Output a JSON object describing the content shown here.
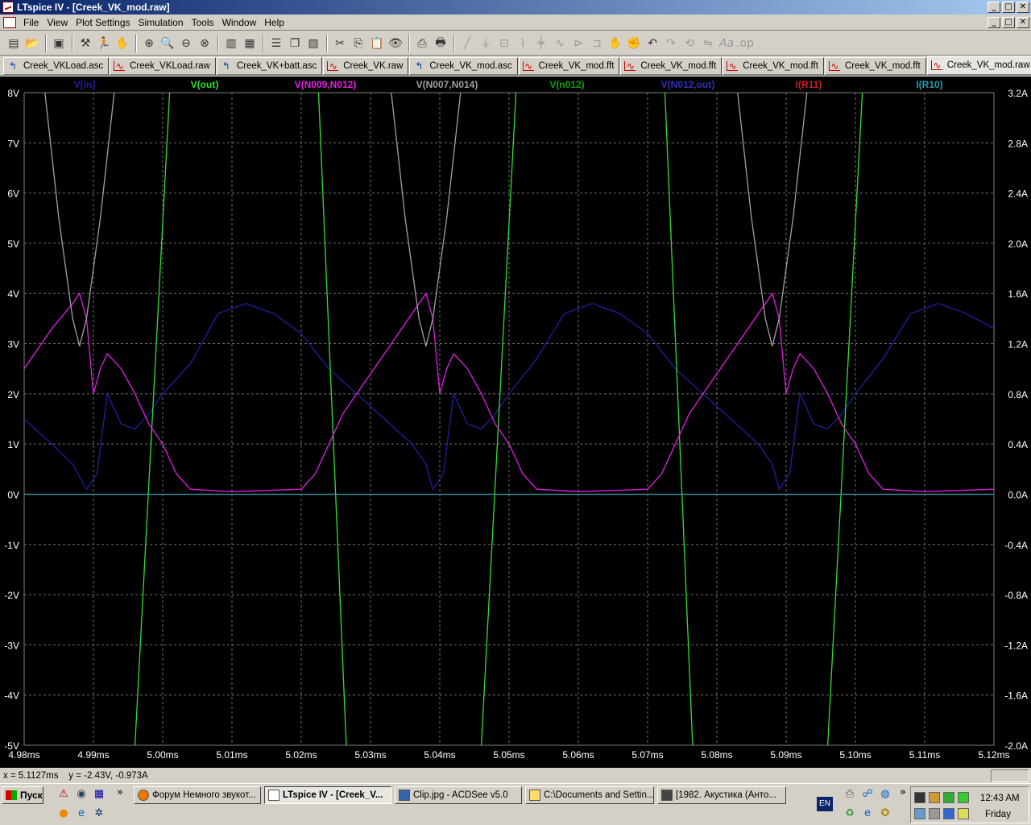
{
  "window": {
    "title": "LTspice IV - [Creek_VK_mod.raw]",
    "btn_min": "_",
    "btn_max": "□",
    "btn_close": "✕"
  },
  "menu": [
    "File",
    "View",
    "Plot Settings",
    "Simulation",
    "Tools",
    "Window",
    "Help"
  ],
  "tabs": [
    {
      "label": "Creek_VKLoad.asc",
      "icon": "schematic-icon"
    },
    {
      "label": "Creek_VKLoad.raw",
      "icon": "waveform-icon"
    },
    {
      "label": "Creek_VK+batt.asc",
      "icon": "schematic-icon"
    },
    {
      "label": "Creek_VK.raw",
      "icon": "waveform-icon"
    },
    {
      "label": "Creek_VK_mod.asc",
      "icon": "schematic-icon"
    },
    {
      "label": "Creek_VK_mod.fft",
      "icon": "waveform-icon"
    },
    {
      "label": "Creek_VK_mod.fft",
      "icon": "waveform-icon"
    },
    {
      "label": "Creek_VK_mod.fft",
      "icon": "waveform-icon"
    },
    {
      "label": "Creek_VK_mod.fft",
      "icon": "waveform-icon"
    },
    {
      "label": "Creek_VK_mod.raw",
      "icon": "waveform-icon"
    }
  ],
  "chart_data": {
    "type": "line",
    "title": "",
    "x_unit": "ms",
    "xlim": [
      4.98,
      5.12
    ],
    "x_ticks": [
      "4.98ms",
      "4.99ms",
      "5.00ms",
      "5.01ms",
      "5.02ms",
      "5.03ms",
      "5.04ms",
      "5.05ms",
      "5.06ms",
      "5.07ms",
      "5.08ms",
      "5.09ms",
      "5.10ms",
      "5.11ms",
      "5.12ms"
    ],
    "ylim_left": [
      -5,
      8
    ],
    "y_ticks_left": [
      "8V",
      "7V",
      "6V",
      "5V",
      "4V",
      "3V",
      "2V",
      "1V",
      "0V",
      "-1V",
      "-2V",
      "-3V",
      "-4V",
      "-5V"
    ],
    "ylim_right": [
      -2.0,
      3.2
    ],
    "y_ticks_right": [
      "3.2A",
      "2.8A",
      "2.4A",
      "2.0A",
      "1.6A",
      "1.2A",
      "0.8A",
      "0.4A",
      "0.0A",
      "-0.4A",
      "-0.8A",
      "-1.2A",
      "-1.6A",
      "-2.0A"
    ],
    "grid": true,
    "background": "#000000",
    "series": [
      {
        "name": "V[in]",
        "color": "#2020a0",
        "axis": "left",
        "points": [
          [
            4.98,
            1.5
          ],
          [
            4.984,
            1.0
          ],
          [
            4.987,
            0.6
          ],
          [
            4.989,
            0.1
          ],
          [
            4.9905,
            0.4
          ],
          [
            4.992,
            2.0
          ],
          [
            4.994,
            1.4
          ],
          [
            4.996,
            1.3
          ],
          [
            4.998,
            1.6
          ],
          [
            5.0,
            2.0
          ],
          [
            5.004,
            2.6
          ],
          [
            5.008,
            3.6
          ],
          [
            5.012,
            3.8
          ],
          [
            5.016,
            3.6
          ],
          [
            5.02,
            3.2
          ],
          [
            5.024,
            2.5
          ],
          [
            5.028,
            2.0
          ],
          [
            5.032,
            1.5
          ],
          [
            5.036,
            1.0
          ],
          [
            5.038,
            0.6
          ],
          [
            5.039,
            0.1
          ],
          [
            5.0405,
            0.4
          ],
          [
            5.042,
            2.0
          ],
          [
            5.044,
            1.4
          ],
          [
            5.046,
            1.3
          ],
          [
            5.048,
            1.6
          ],
          [
            5.05,
            2.0
          ],
          [
            5.054,
            2.7
          ],
          [
            5.058,
            3.6
          ],
          [
            5.062,
            3.8
          ],
          [
            5.066,
            3.6
          ],
          [
            5.07,
            3.2
          ],
          [
            5.074,
            2.5
          ],
          [
            5.078,
            2.0
          ],
          [
            5.082,
            1.5
          ],
          [
            5.086,
            1.0
          ],
          [
            5.088,
            0.6
          ],
          [
            5.089,
            0.1
          ],
          [
            5.0905,
            0.4
          ],
          [
            5.092,
            2.0
          ],
          [
            5.094,
            1.4
          ],
          [
            5.096,
            1.3
          ],
          [
            5.098,
            1.6
          ],
          [
            5.1,
            2.0
          ],
          [
            5.104,
            2.7
          ],
          [
            5.108,
            3.6
          ],
          [
            5.112,
            3.8
          ],
          [
            5.116,
            3.6
          ],
          [
            5.12,
            3.3
          ]
        ]
      },
      {
        "name": "V(out)",
        "color": "#30e030",
        "axis": "left",
        "points": [
          [
            4.996,
            -5
          ],
          [
            5.001,
            8
          ]
        ],
        "segments": [
          [
            [
              4.996,
              -5
            ],
            [
              5.001,
              8
            ]
          ],
          [
            [
              5.0225,
              8
            ],
            [
              5.0265,
              -5
            ]
          ],
          [
            [
              5.046,
              -5
            ],
            [
              5.051,
              8
            ]
          ],
          [
            [
              5.0725,
              8
            ],
            [
              5.0765,
              -5
            ]
          ],
          [
            [
              5.096,
              -5
            ],
            [
              5.101,
              8
            ]
          ]
        ]
      },
      {
        "name": "V(N009,N012)",
        "color": "#e020e0",
        "axis": "left",
        "points": [
          [
            4.98,
            2.5
          ],
          [
            4.984,
            3.3
          ],
          [
            4.987,
            3.8
          ],
          [
            4.988,
            4.0
          ],
          [
            4.989,
            3.5
          ],
          [
            4.99,
            2.0
          ],
          [
            4.991,
            2.5
          ],
          [
            4.992,
            2.8
          ],
          [
            4.994,
            2.5
          ],
          [
            4.996,
            2.0
          ],
          [
            4.998,
            1.4
          ],
          [
            5.0,
            1.0
          ],
          [
            5.002,
            0.4
          ],
          [
            5.004,
            0.1
          ],
          [
            5.01,
            0.05
          ],
          [
            5.02,
            0.1
          ],
          [
            5.022,
            0.4
          ],
          [
            5.024,
            1.0
          ],
          [
            5.026,
            1.6
          ],
          [
            5.03,
            2.4
          ],
          [
            5.034,
            3.2
          ],
          [
            5.037,
            3.8
          ],
          [
            5.038,
            4.0
          ],
          [
            5.039,
            3.5
          ],
          [
            5.04,
            2.0
          ],
          [
            5.041,
            2.5
          ],
          [
            5.042,
            2.8
          ],
          [
            5.044,
            2.5
          ],
          [
            5.046,
            2.0
          ],
          [
            5.048,
            1.4
          ],
          [
            5.05,
            1.0
          ],
          [
            5.052,
            0.4
          ],
          [
            5.054,
            0.1
          ],
          [
            5.06,
            0.05
          ],
          [
            5.07,
            0.1
          ],
          [
            5.072,
            0.4
          ],
          [
            5.074,
            1.0
          ],
          [
            5.076,
            1.6
          ],
          [
            5.08,
            2.4
          ],
          [
            5.084,
            3.2
          ],
          [
            5.087,
            3.8
          ],
          [
            5.088,
            4.0
          ],
          [
            5.089,
            3.5
          ],
          [
            5.09,
            2.0
          ],
          [
            5.091,
            2.5
          ],
          [
            5.092,
            2.8
          ],
          [
            5.094,
            2.5
          ],
          [
            5.096,
            2.0
          ],
          [
            5.098,
            1.4
          ],
          [
            5.1,
            1.0
          ],
          [
            5.102,
            0.4
          ],
          [
            5.104,
            0.1
          ],
          [
            5.11,
            0.05
          ],
          [
            5.12,
            0.1
          ]
        ]
      },
      {
        "name": "V(N007,N014)",
        "color": "#a0a0a0",
        "axis": "left",
        "points": [
          [
            4.983,
            8
          ],
          [
            4.985,
            5.5
          ],
          [
            4.987,
            3.5
          ],
          [
            4.988,
            2.95
          ],
          [
            4.989,
            3.5
          ],
          [
            4.991,
            5.5
          ],
          [
            4.993,
            8
          ]
        ],
        "segments": [
          [
            [
              4.983,
              8
            ],
            [
              4.985,
              5.5
            ],
            [
              4.987,
              3.5
            ],
            [
              4.988,
              2.95
            ],
            [
              4.989,
              3.5
            ],
            [
              4.991,
              5.5
            ],
            [
              4.993,
              8
            ]
          ],
          [
            [
              5.033,
              8
            ],
            [
              5.035,
              5.5
            ],
            [
              5.037,
              3.5
            ],
            [
              5.038,
              2.95
            ],
            [
              5.039,
              3.5
            ],
            [
              5.041,
              5.5
            ],
            [
              5.043,
              8
            ]
          ],
          [
            [
              5.083,
              8
            ],
            [
              5.085,
              5.5
            ],
            [
              5.087,
              3.5
            ],
            [
              5.088,
              2.95
            ],
            [
              5.089,
              3.5
            ],
            [
              5.091,
              5.5
            ],
            [
              5.093,
              8
            ]
          ]
        ]
      },
      {
        "name": "V(n012)",
        "color": "#10a010",
        "axis": "left",
        "points": []
      },
      {
        "name": "V(N012,out)",
        "color": "#3030c0",
        "axis": "left",
        "points": []
      },
      {
        "name": "I(R11)",
        "color": "#d02020",
        "axis": "right",
        "points": [
          [
            4.98,
            0
          ],
          [
            5.12,
            0
          ]
        ]
      },
      {
        "name": "I(R10)",
        "color": "#20a0b0",
        "axis": "right",
        "points": [
          [
            4.98,
            0
          ],
          [
            5.12,
            0
          ]
        ]
      }
    ]
  },
  "status": {
    "readout": "x = 5.1127ms    y = -2.43V, -0.973A"
  },
  "taskbar": {
    "start": "Пуск",
    "overflow": "»",
    "tasks": [
      {
        "label": "Форум Немного звукот..."
      },
      {
        "label": "LTspice IV - [Creek_V..."
      },
      {
        "label": "Clip.jpg - ACDSee v5.0"
      },
      {
        "label": "C:\\Documents and Settin..."
      },
      {
        "label": "[1982. Акустика (Анто..."
      }
    ],
    "lang": "EN",
    "clock": "12:43 AM",
    "day": "Friday"
  }
}
